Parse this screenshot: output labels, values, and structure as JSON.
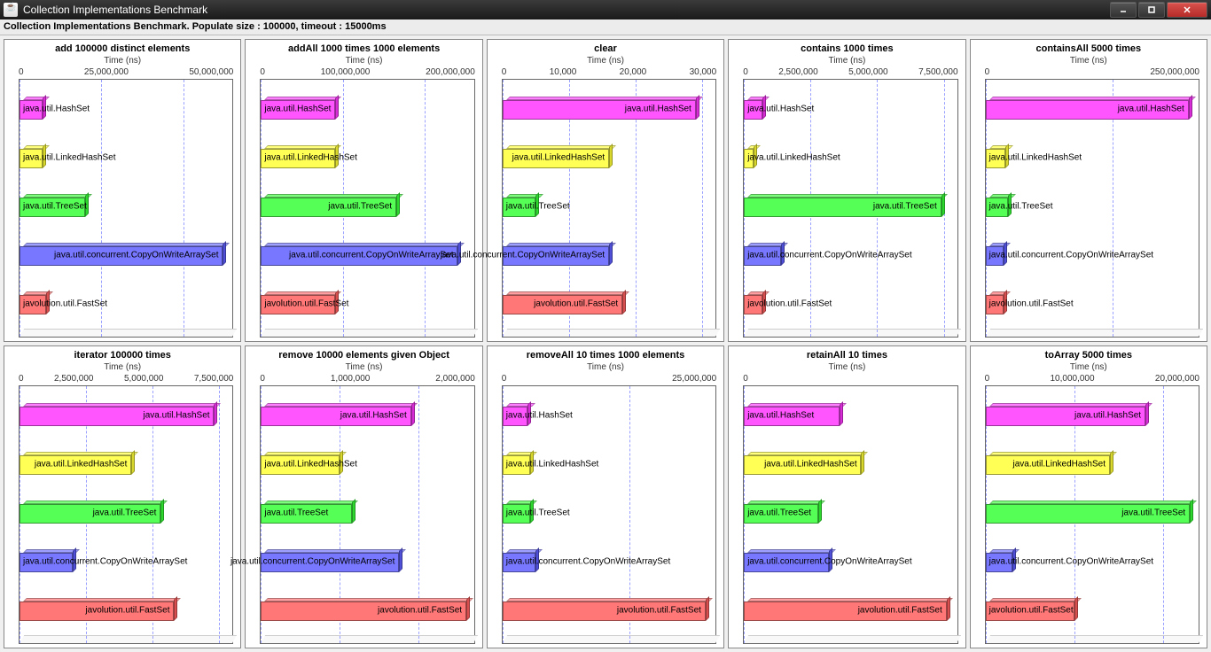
{
  "window": {
    "title": "Collection Implementations Benchmark"
  },
  "subtitle": "Collection Implementations Benchmark. Populate size : 100000, timeout : 15000ms",
  "series_names": [
    "java.util.HashSet",
    "java.util.LinkedHashSet",
    "java.util.TreeSet",
    "java.util.concurrent.CopyOnWriteArraySet",
    "javolution.util.FastSet"
  ],
  "series_colors": [
    "#ff55ff",
    "#ffff55",
    "#55ff55",
    "#7777ff",
    "#ff7777"
  ],
  "axis_label": "Time (ns)",
  "chart_data": [
    {
      "type": "bar",
      "title": "add 100000 distinct elements",
      "xlabel": "Time (ns)",
      "ticks": [
        "0",
        "25,000,000",
        "50,000,000"
      ],
      "max": 65000000,
      "categories": [
        "java.util.HashSet",
        "java.util.LinkedHashSet",
        "java.util.TreeSet",
        "java.util.concurrent.CopyOnWriteArraySet",
        "javolution.util.FastSet"
      ],
      "values": [
        7000000,
        7000000,
        20000000,
        62000000,
        8000000
      ]
    },
    {
      "type": "bar",
      "title": "addAll 1000 times 1000 elements",
      "xlabel": "Time (ns)",
      "ticks": [
        "0",
        "100,000,000",
        "200,000,000"
      ],
      "max": 260000000,
      "categories": [
        "java.util.HashSet",
        "java.util.LinkedHashSet",
        "java.util.TreeSet",
        "java.util.concurrent.CopyOnWriteArraySet",
        "javolution.util.FastSet"
      ],
      "values": [
        90000000,
        90000000,
        165000000,
        240000000,
        90000000
      ]
    },
    {
      "type": "bar",
      "title": "clear",
      "xlabel": "Time (ns)",
      "ticks": [
        "0",
        "10,000",
        "20,000",
        "30,000"
      ],
      "max": 32000,
      "categories": [
        "java.util.HashSet",
        "java.util.LinkedHashSet",
        "java.util.TreeSet",
        "java.util.concurrent.CopyOnWriteArraySet",
        "javolution.util.FastSet"
      ],
      "values": [
        29000,
        16000,
        5000,
        16000,
        18000
      ]
    },
    {
      "type": "bar",
      "title": "contains 1000 times",
      "xlabel": "Time (ns)",
      "ticks": [
        "0",
        "2,500,000",
        "5,000,000",
        "7,500,000"
      ],
      "max": 8000000,
      "categories": [
        "java.util.HashSet",
        "java.util.LinkedHashSet",
        "java.util.TreeSet",
        "java.util.concurrent.CopyOnWriteArraySet",
        "javolution.util.FastSet"
      ],
      "values": [
        700000,
        350000,
        7400000,
        1400000,
        700000
      ]
    },
    {
      "type": "bar",
      "title": "containsAll 5000 times",
      "xlabel": "Time (ns)",
      "ticks": [
        "0",
        "250,000,000"
      ],
      "max": 420000000,
      "categories": [
        "java.util.HashSet",
        "java.util.LinkedHashSet",
        "java.util.TreeSet",
        "java.util.concurrent.CopyOnWriteArraySet",
        "javolution.util.FastSet"
      ],
      "values": [
        400000000,
        40000000,
        45000000,
        35000000,
        35000000
      ]
    },
    {
      "type": "bar",
      "title": "iterator 100000 times",
      "xlabel": "Time (ns)",
      "ticks": [
        "0",
        "2,500,000",
        "5,000,000",
        "7,500,000"
      ],
      "max": 8000000,
      "categories": [
        "java.util.HashSet",
        "java.util.LinkedHashSet",
        "java.util.TreeSet",
        "java.util.concurrent.CopyOnWriteArraySet",
        "javolution.util.FastSet"
      ],
      "values": [
        7300000,
        4200000,
        5300000,
        2000000,
        5800000
      ]
    },
    {
      "type": "bar",
      "title": "remove 10000 elements given Object",
      "xlabel": "Time (ns)",
      "ticks": [
        "0",
        "1,000,000",
        "2,000,000"
      ],
      "max": 2700000,
      "categories": [
        "java.util.HashSet",
        "java.util.LinkedHashSet",
        "java.util.TreeSet",
        "java.util.concurrent.CopyOnWriteArraySet",
        "javolution.util.FastSet"
      ],
      "values": [
        1900000,
        1000000,
        1150000,
        1750000,
        2600000
      ]
    },
    {
      "type": "bar",
      "title": "removeAll 10 times 1000 elements",
      "xlabel": "Time (ns)",
      "ticks": [
        "0",
        "25,000,000"
      ],
      "max": 42000000,
      "categories": [
        "java.util.HashSet",
        "java.util.LinkedHashSet",
        "java.util.TreeSet",
        "java.util.concurrent.CopyOnWriteArraySet",
        "javolution.util.FastSet"
      ],
      "values": [
        5000000,
        5500000,
        5500000,
        6500000,
        40000000
      ]
    },
    {
      "type": "bar",
      "title": "retainAll 10 times",
      "xlabel": "Time (ns)",
      "ticks": [
        "0"
      ],
      "max": 100,
      "categories": [
        "java.util.HashSet",
        "java.util.LinkedHashSet",
        "java.util.TreeSet",
        "java.util.concurrent.CopyOnWriteArraySet",
        "javolution.util.FastSet"
      ],
      "values": [
        45,
        55,
        35,
        40,
        95
      ]
    },
    {
      "type": "bar",
      "title": "toArray 5000 times",
      "xlabel": "Time (ns)",
      "ticks": [
        "0",
        "10,000,000",
        "20,000,000"
      ],
      "max": 24000000,
      "categories": [
        "java.util.HashSet",
        "java.util.LinkedHashSet",
        "java.util.TreeSet",
        "java.util.concurrent.CopyOnWriteArraySet",
        "javolution.util.FastSet"
      ],
      "values": [
        18000000,
        14000000,
        23000000,
        3000000,
        10000000
      ]
    }
  ]
}
